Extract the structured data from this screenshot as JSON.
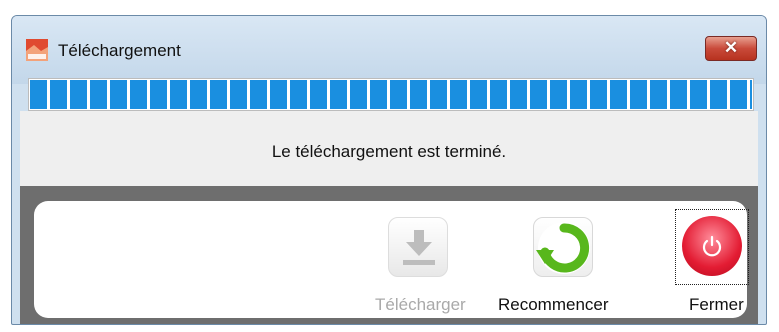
{
  "window": {
    "title": "Téléchargement",
    "close_glyph": "✕",
    "app_icon": "app-logo-icon"
  },
  "progress": {
    "value_percent": 100,
    "color": "#1a8fe0"
  },
  "status": {
    "message": "Le téléchargement est terminé."
  },
  "actions": [
    {
      "label": "Télécharger",
      "icon": "download-icon",
      "enabled": false
    },
    {
      "label": "Recommencer",
      "icon": "restart-arrow-icon",
      "enabled": true
    },
    {
      "label": "Fermer",
      "icon": "power-icon",
      "enabled": true,
      "focused": true
    }
  ],
  "colors": {
    "restart_green": "#58b71c",
    "power_red": "#e31c33"
  }
}
